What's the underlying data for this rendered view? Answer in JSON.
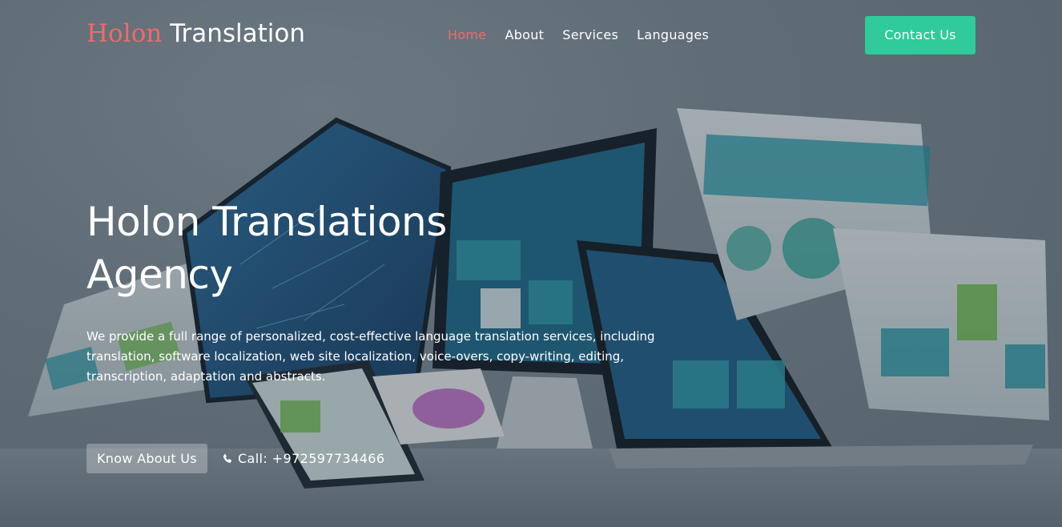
{
  "brand": {
    "accent": "Holon",
    "main": "Translation"
  },
  "nav": {
    "items": [
      {
        "label": "Home",
        "active": true
      },
      {
        "label": "About",
        "active": false
      },
      {
        "label": "Services",
        "active": false
      },
      {
        "label": "Languages",
        "active": false
      }
    ],
    "contact_label": "Contact Us"
  },
  "hero": {
    "title_line1": "Holon Translations",
    "title_line2": "Agency",
    "description": "We provide a full range of personalized, cost-effective language translation services, including translation, software localization, web site localization, voice-overs, copy-writing, editing, transcription, adaptation and abstracts.",
    "know_button": "Know About Us",
    "call_text": "Call: +972597734466",
    "background_icon": "devices-photo"
  },
  "colors": {
    "accent_red": "#f06a6a",
    "contact_green": "#2fcb9a",
    "text_white": "#ffffff"
  }
}
